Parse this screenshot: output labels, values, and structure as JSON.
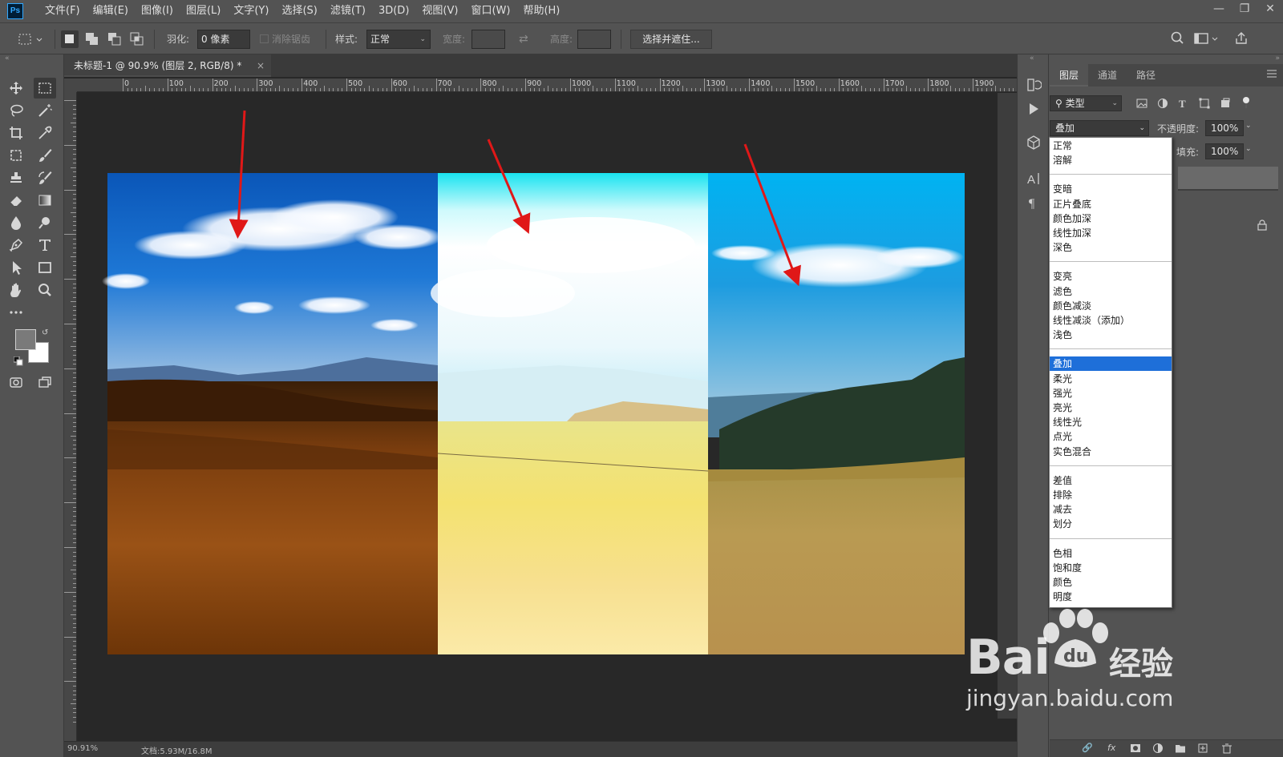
{
  "app": {
    "logo": "Ps",
    "menu": [
      "文件(F)",
      "编辑(E)",
      "图像(I)",
      "图层(L)",
      "文字(Y)",
      "选择(S)",
      "滤镜(T)",
      "3D(D)",
      "视图(V)",
      "窗口(W)",
      "帮助(H)"
    ],
    "window_controls": [
      "minimize-icon",
      "restore-icon",
      "close-icon"
    ]
  },
  "options": {
    "feather_label": "羽化:",
    "feather_value": "0 像素",
    "antialias_label": "消除锯齿",
    "style_label": "样式:",
    "style_value": "正常",
    "width_label": "宽度:",
    "height_label": "高度:",
    "select_mask_button": "选择并遮住..."
  },
  "document": {
    "tab_title": "未标题-1 @ 90.9% (图层 2, RGB/8) *",
    "tab_close": "×",
    "ruler_labels": [
      "0",
      "100",
      "200",
      "300",
      "400",
      "500",
      "600",
      "700",
      "800",
      "900",
      "1000",
      "1100",
      "1200",
      "1300",
      "1400",
      "1500",
      "1600",
      "1700",
      "1800",
      "1900"
    ],
    "status_zoom": "90.91%",
    "status_doc": "文档:5.93M/16.8M"
  },
  "canvas": {
    "panels": [
      "normal",
      "screen",
      "overlay"
    ],
    "arrow_color": "#e01818"
  },
  "layers_panel": {
    "tabs": [
      "图层",
      "通道",
      "路径"
    ],
    "filter_kind": "类型",
    "blend_mode": "叠加",
    "opacity_label": "不透明度:",
    "opacity_value": "100%",
    "fill_label": "填充:",
    "fill_value": "100%"
  },
  "blend_modes": {
    "groups": [
      [
        "正常",
        "溶解"
      ],
      [
        "变暗",
        "正片叠底",
        "颜色加深",
        "线性加深",
        "深色"
      ],
      [
        "变亮",
        "滤色",
        "颜色减淡",
        "线性减淡（添加）",
        "浅色"
      ],
      [
        "叠加",
        "柔光",
        "强光",
        "亮光",
        "线性光",
        "点光",
        "实色混合"
      ],
      [
        "差值",
        "排除",
        "减去",
        "划分"
      ],
      [
        "色相",
        "饱和度",
        "颜色",
        "明度"
      ]
    ],
    "selected": "叠加",
    "selected_color": "#1e6fd9"
  },
  "watermark": {
    "brand": "Bai",
    "brand_suffix": "经验",
    "url": "jingyan.baidu.com"
  }
}
